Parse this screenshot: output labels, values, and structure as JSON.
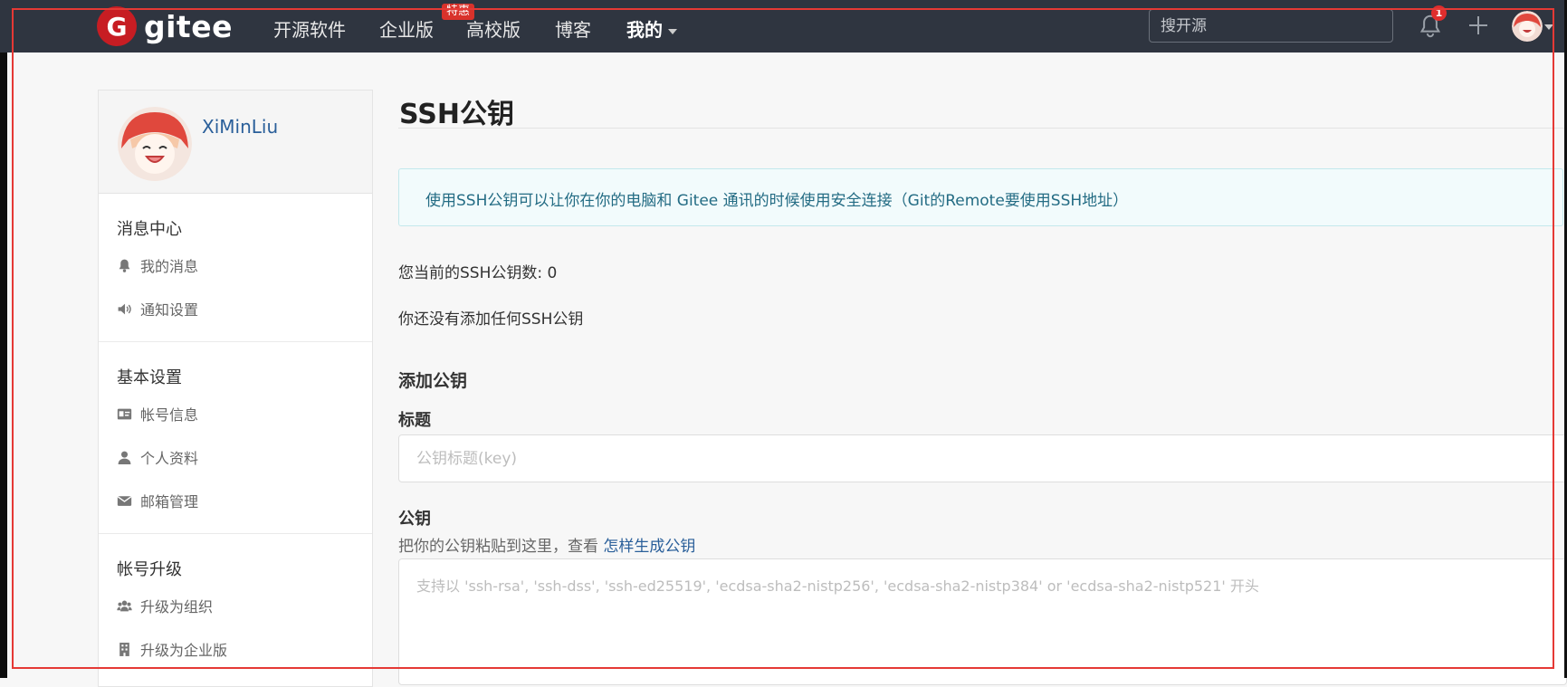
{
  "nav": {
    "logo_letter": "G",
    "logo_text": "gitee",
    "items": [
      {
        "label": "开源软件"
      },
      {
        "label": "企业版"
      },
      {
        "label": "高校版"
      },
      {
        "label": "博客"
      },
      {
        "label": "我的"
      }
    ],
    "enterprise_badge": "特惠",
    "search_placeholder": "搜开源",
    "notification_count": "1"
  },
  "sidebar": {
    "username": "XiMinLiu",
    "sections": [
      {
        "title": "消息中心",
        "items": [
          {
            "label": "我的消息",
            "icon": "bell-icon"
          },
          {
            "label": "通知设置",
            "icon": "volume-icon"
          }
        ]
      },
      {
        "title": "基本设置",
        "items": [
          {
            "label": "帐号信息",
            "icon": "id-card-icon"
          },
          {
            "label": "个人资料",
            "icon": "user-icon"
          },
          {
            "label": "邮箱管理",
            "icon": "envelope-icon"
          }
        ]
      },
      {
        "title": "帐号升级",
        "items": [
          {
            "label": "升级为组织",
            "icon": "users-icon"
          },
          {
            "label": "升级为企业版",
            "icon": "building-icon"
          }
        ]
      }
    ]
  },
  "main": {
    "title": "SSH公钥",
    "info": "使用SSH公钥可以让你在你的电脑和 Gitee 通讯的时候使用安全连接（Git的Remote要使用SSH地址）",
    "count_text": "您当前的SSH公钥数: 0",
    "empty_text": "你还没有添加任何SSH公钥",
    "add_title": "添加公钥",
    "title_label": "标题",
    "title_placeholder": "公钥标题(key)",
    "key_label": "公钥",
    "key_hint": "把你的公钥粘贴到这里，查看 ",
    "key_hint_link": "怎样生成公钥",
    "key_placeholder": "支持以 'ssh-rsa', 'ssh-dss', 'ssh-ed25519', 'ecdsa-sha2-nistp256', 'ecdsa-sha2-nistp384' or 'ecdsa-sha2-nistp521' 开头"
  },
  "colors": {
    "navbar": "#2f3540",
    "brand_red": "#c71d23",
    "link": "#2a5f9a",
    "info_bg": "#f2fbfc",
    "highlight": "#e53935"
  }
}
